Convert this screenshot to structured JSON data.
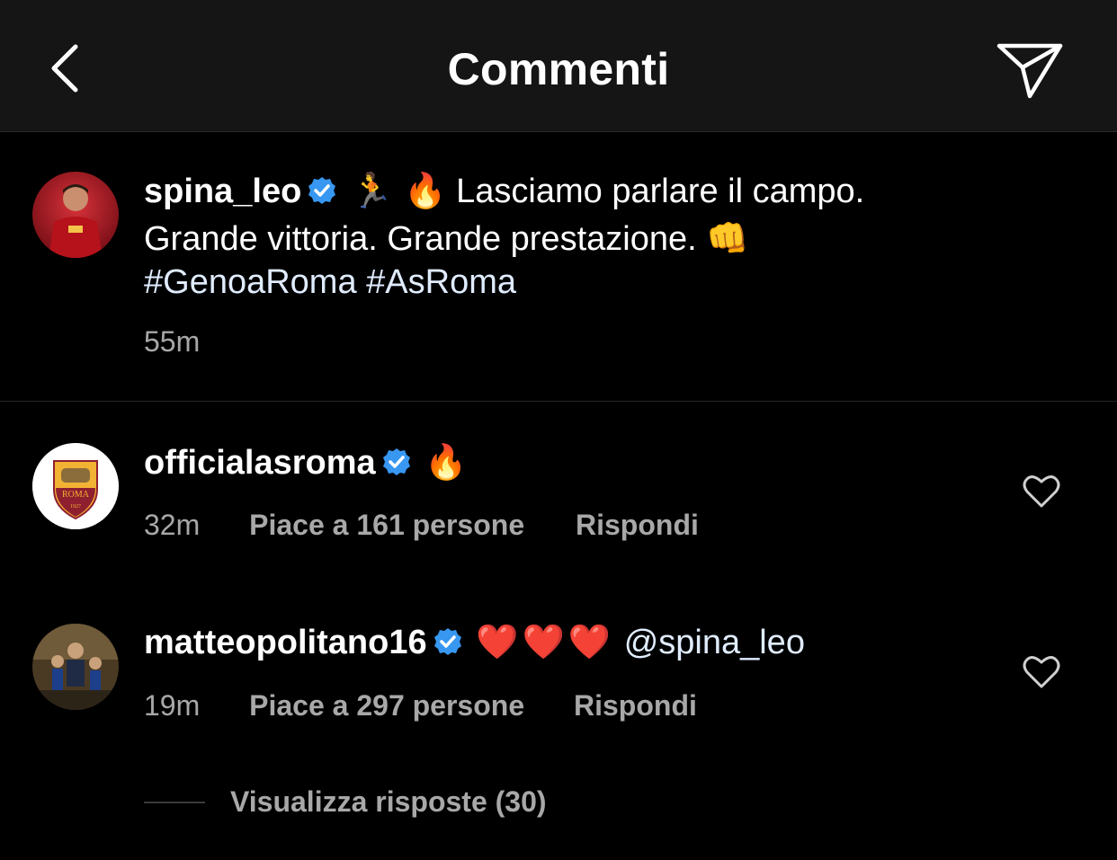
{
  "header": {
    "title": "Commenti",
    "back_icon": "back-chevron-icon",
    "send_icon": "direct-send-icon"
  },
  "post": {
    "username": "spina_leo",
    "verified": true,
    "emojis": "🏃 🔥",
    "text_line1": "Lasciamo parlare il campo.",
    "text_line2": "Grande vittoria. Grande prestazione.",
    "text_line2_emoji": "👊",
    "hashtags": [
      "#GenoaRoma",
      "#AsRoma"
    ],
    "time": "55m"
  },
  "comments": [
    {
      "username": "officialasroma",
      "verified": true,
      "text": "🔥",
      "time": "32m",
      "likes": "Piace a 161 persone",
      "reply": "Rispondi",
      "avatar_text": "ROMA",
      "avatar_year": "1927"
    },
    {
      "username": "matteopolitano16",
      "verified": true,
      "text": "❤️❤️❤️",
      "mention": "@spina_leo",
      "time": "19m",
      "likes": "Piace a 297 persone",
      "reply": "Rispondi",
      "view_replies": "Visualizza risposte (30)"
    }
  ],
  "colors": {
    "background": "#000000",
    "header_bg": "#151515",
    "secondary_text": "#a8a8a8",
    "verified_blue": "#3897f0",
    "hashtag": "#e0ecff",
    "heart_red": "#e0245e"
  }
}
